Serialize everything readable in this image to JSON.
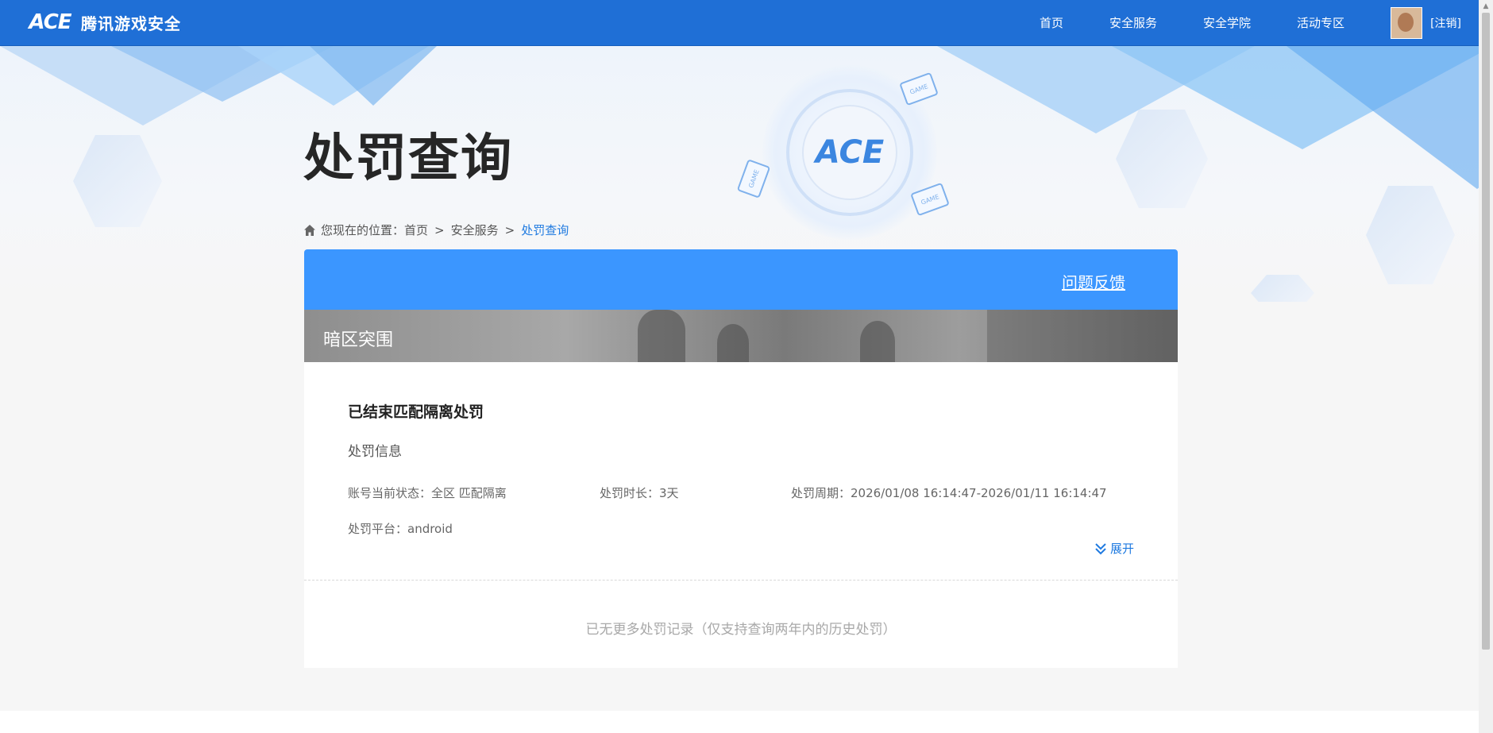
{
  "brand": {
    "logo_text": "ACE",
    "name": "腾讯游戏安全"
  },
  "nav": {
    "items": [
      "首页",
      "安全服务",
      "安全学院",
      "活动专区"
    ],
    "logout": "[注销]"
  },
  "hero": {
    "title": "处罚查询",
    "emblem_text": "ACE",
    "game_tags": [
      "GAME",
      "GAME",
      "GAME"
    ]
  },
  "breadcrumb": {
    "prefix": "您现在的位置：",
    "items": [
      "首页",
      "安全服务"
    ],
    "separator": ">",
    "current": "处罚查询"
  },
  "card": {
    "feedback_link": "问题反馈",
    "game_name": "暗区突围",
    "record": {
      "title": "已结束匹配隔离处罚",
      "section_label": "处罚信息",
      "status": "账号当前状态：全区 匹配隔离",
      "duration": "处罚时长：3天",
      "period": "处罚周期：2026/01/08 16:14:47-2026/01/11 16:14:47",
      "platform": "处罚平台：android"
    },
    "expand_label": "展开",
    "no_more_text": "已无更多处罚记录（仅支持查询两年内的历史处罚）"
  },
  "colors": {
    "topbar": "#1f6fd6",
    "card_header": "#3b96ff",
    "accent_link": "#1f7ae0"
  }
}
